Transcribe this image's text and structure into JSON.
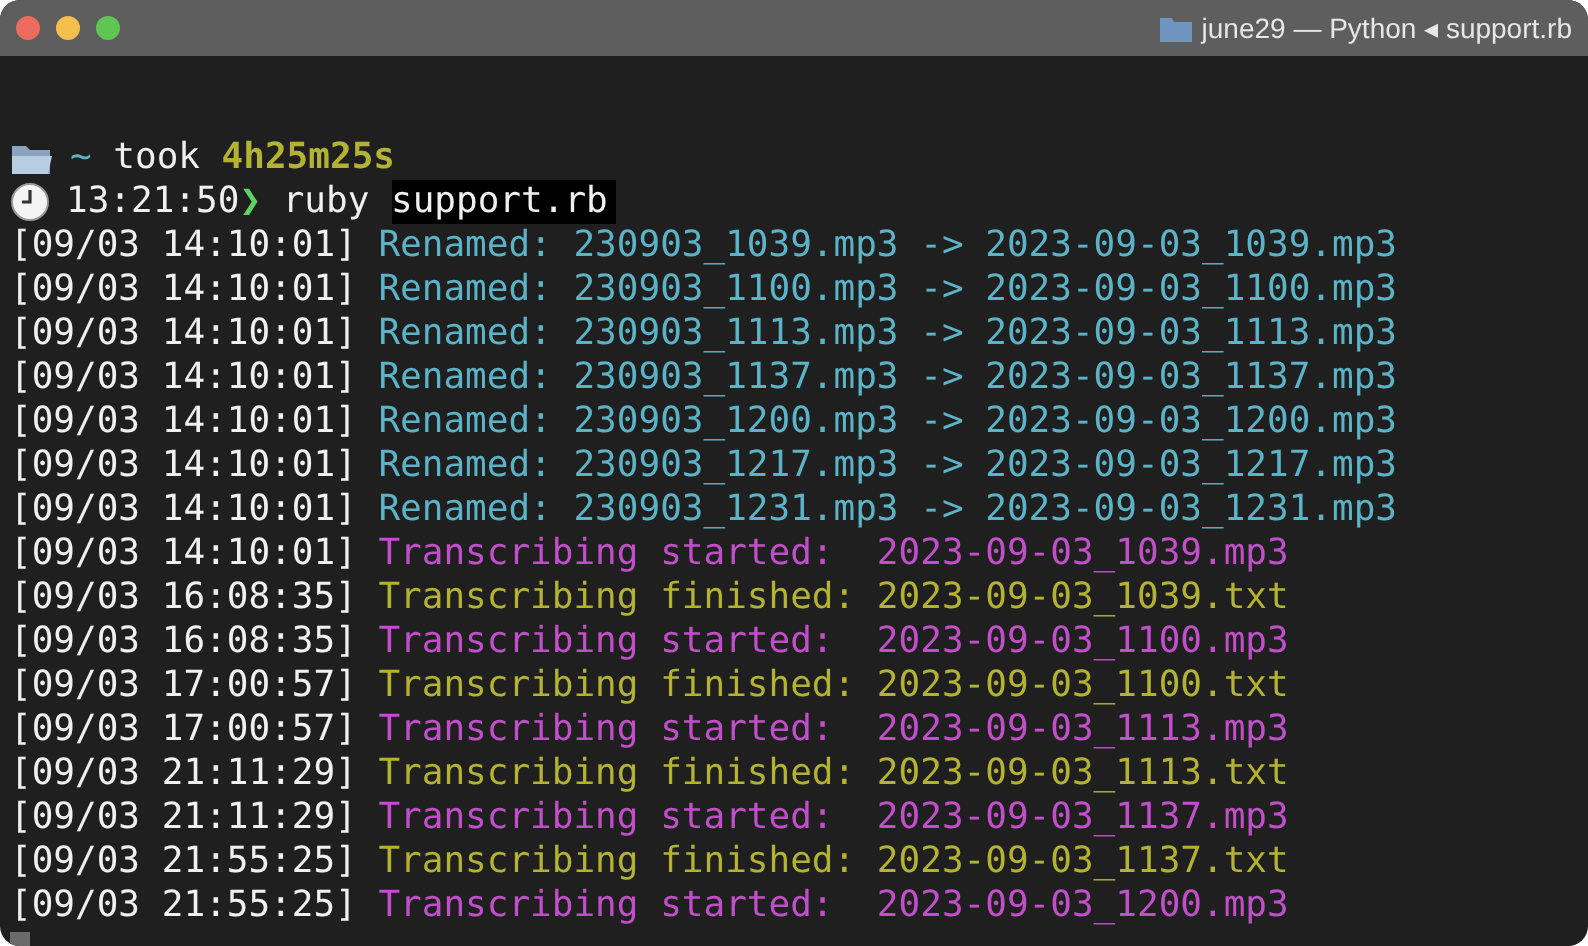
{
  "window": {
    "title": "june29 — Python ◂ support.rb"
  },
  "prompt": {
    "dir": "~",
    "took_label": "took",
    "duration": "4h25m25s",
    "time": "13:21:50",
    "symbol": "❯",
    "command": "ruby",
    "argument": "support.rb",
    "argument_selected": true
  },
  "log": [
    {
      "time": "[09/03 14:10:01]",
      "message": "Renamed: 230903_1039.mp3 -> 2023-09-03_1039.mp3",
      "color": "#5bb3c7"
    },
    {
      "time": "[09/03 14:10:01]",
      "message": "Renamed: 230903_1100.mp3 -> 2023-09-03_1100.mp3",
      "color": "#5bb3c7"
    },
    {
      "time": "[09/03 14:10:01]",
      "message": "Renamed: 230903_1113.mp3 -> 2023-09-03_1113.mp3",
      "color": "#5bb3c7"
    },
    {
      "time": "[09/03 14:10:01]",
      "message": "Renamed: 230903_1137.mp3 -> 2023-09-03_1137.mp3",
      "color": "#5bb3c7"
    },
    {
      "time": "[09/03 14:10:01]",
      "message": "Renamed: 230903_1200.mp3 -> 2023-09-03_1200.mp3",
      "color": "#5bb3c7"
    },
    {
      "time": "[09/03 14:10:01]",
      "message": "Renamed: 230903_1217.mp3 -> 2023-09-03_1217.mp3",
      "color": "#5bb3c7"
    },
    {
      "time": "[09/03 14:10:01]",
      "message": "Renamed: 230903_1231.mp3 -> 2023-09-03_1231.mp3",
      "color": "#5bb3c7"
    },
    {
      "time": "[09/03 14:10:01]",
      "message": "Transcribing started:  2023-09-03_1039.mp3",
      "color": "#c14fc9"
    },
    {
      "time": "[09/03 16:08:35]",
      "message": "Transcribing finished: 2023-09-03_1039.txt",
      "color": "#b4b232"
    },
    {
      "time": "[09/03 16:08:35]",
      "message": "Transcribing started:  2023-09-03_1100.mp3",
      "color": "#c14fc9"
    },
    {
      "time": "[09/03 17:00:57]",
      "message": "Transcribing finished: 2023-09-03_1100.txt",
      "color": "#b4b232"
    },
    {
      "time": "[09/03 17:00:57]",
      "message": "Transcribing started:  2023-09-03_1113.mp3",
      "color": "#c14fc9"
    },
    {
      "time": "[09/03 21:11:29]",
      "message": "Transcribing finished: 2023-09-03_1113.txt",
      "color": "#b4b232"
    },
    {
      "time": "[09/03 21:11:29]",
      "message": "Transcribing started:  2023-09-03_1137.mp3",
      "color": "#c14fc9"
    },
    {
      "time": "[09/03 21:55:25]",
      "message": "Transcribing finished: 2023-09-03_1137.txt",
      "color": "#b4b232"
    },
    {
      "time": "[09/03 21:55:25]",
      "message": "Transcribing started:  2023-09-03_1200.mp3",
      "color": "#c14fc9"
    }
  ]
}
